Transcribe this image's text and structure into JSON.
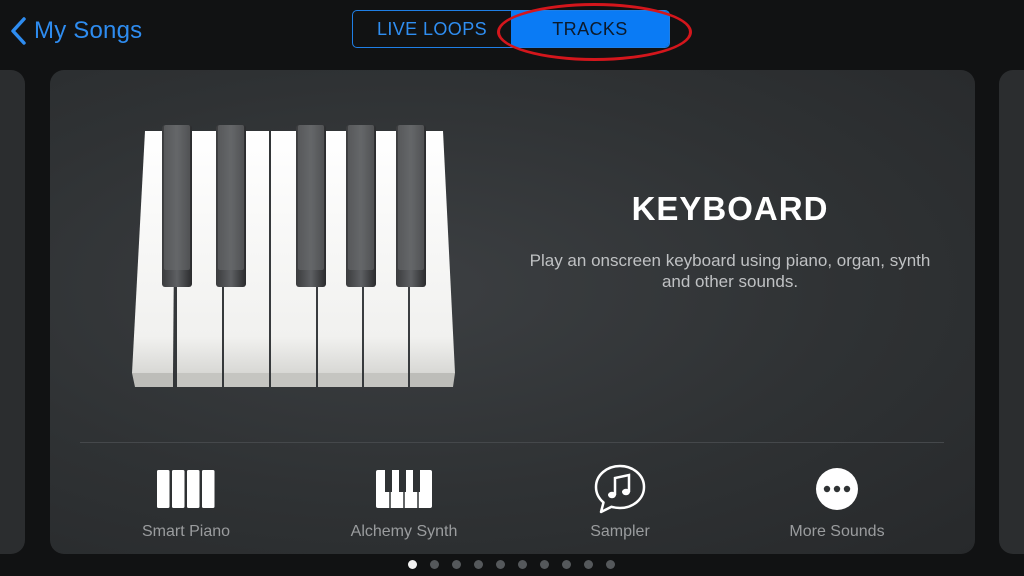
{
  "header": {
    "back_label": "My Songs",
    "tabs": [
      {
        "label": "LIVE LOOPS",
        "selected": false
      },
      {
        "label": "TRACKS",
        "selected": true
      }
    ],
    "accent_color": "#0a7bf5",
    "highlight_color": "#d4161c"
  },
  "instrument": {
    "title": "KEYBOARD",
    "description": "Play an onscreen keyboard using piano, organ, synth and other sounds.",
    "icon": "piano-keys-icon"
  },
  "options": [
    {
      "label": "Smart Piano",
      "icon": "smart-piano-icon"
    },
    {
      "label": "Alchemy Synth",
      "icon": "synth-keys-icon"
    },
    {
      "label": "Sampler",
      "icon": "sampler-icon"
    },
    {
      "label": "More Sounds",
      "icon": "more-icon"
    }
  ],
  "pagination": {
    "total": 10,
    "current": 1
  }
}
